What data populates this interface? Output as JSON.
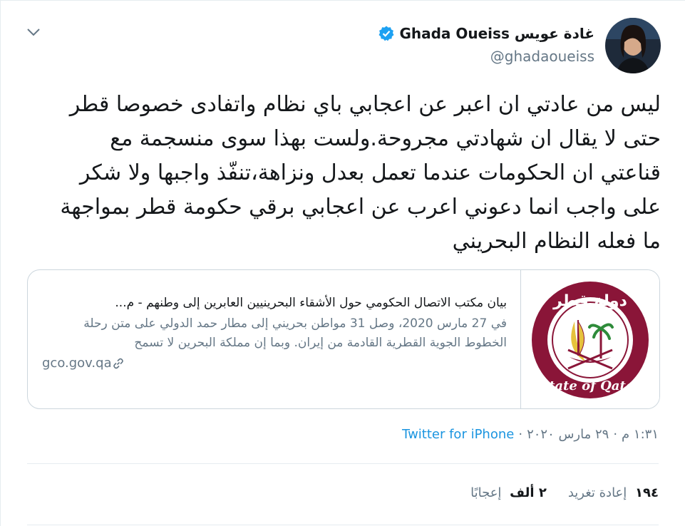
{
  "author": {
    "name": "Ghada Oueiss غادة عويس",
    "handle": "@ghadaoueiss",
    "verified": true
  },
  "tweet": {
    "text": "ليس من عادتي ان اعبر عن اعجابي باي نظام واتفادى خصوصا قطر حتى لا يقال ان شهادتي مجروحة.ولست بهذا سوى منسجمة مع قناعتي ان الحكومات عندما تعمل بعدل ونزاهة،تنفّذ واجبها ولا شكر على واجب انما دعوني اعرب عن اعجابي برقي حكومة قطر بمواجهة ما فعله النظام البحريني"
  },
  "card": {
    "image_text_top": "دولة قطر",
    "image_text_bottom": "State of Qatar",
    "title": "بيان مكتب الاتصال الحكومي حول الأشقاء البحرينيين العابرين إلى وطنهم - م...",
    "description": "في 27 مارس 2020، وصل 31 مواطن بحريني إلى مطار حمد الدولي على متن رحلة الخطوط الجوية القطرية القادمة من إيران. وبما إن مملكة البحرين لا تسمح",
    "domain": "gco.gov.qa"
  },
  "meta": {
    "time": "١:٣١ م",
    "date": "٢٩ مارس ٢٠٢٠",
    "separator": "·",
    "source": "Twitter for iPhone"
  },
  "stats": {
    "retweets_count": "١٩٤",
    "retweets_label": "إعادة تغريد",
    "likes_count": "٢ ألف",
    "likes_label": "إعجابًا"
  },
  "colors": {
    "link": "#1b95e0",
    "muted": "#657786",
    "border": "#ccd6dd",
    "qatar_maroon": "#8a1538"
  }
}
